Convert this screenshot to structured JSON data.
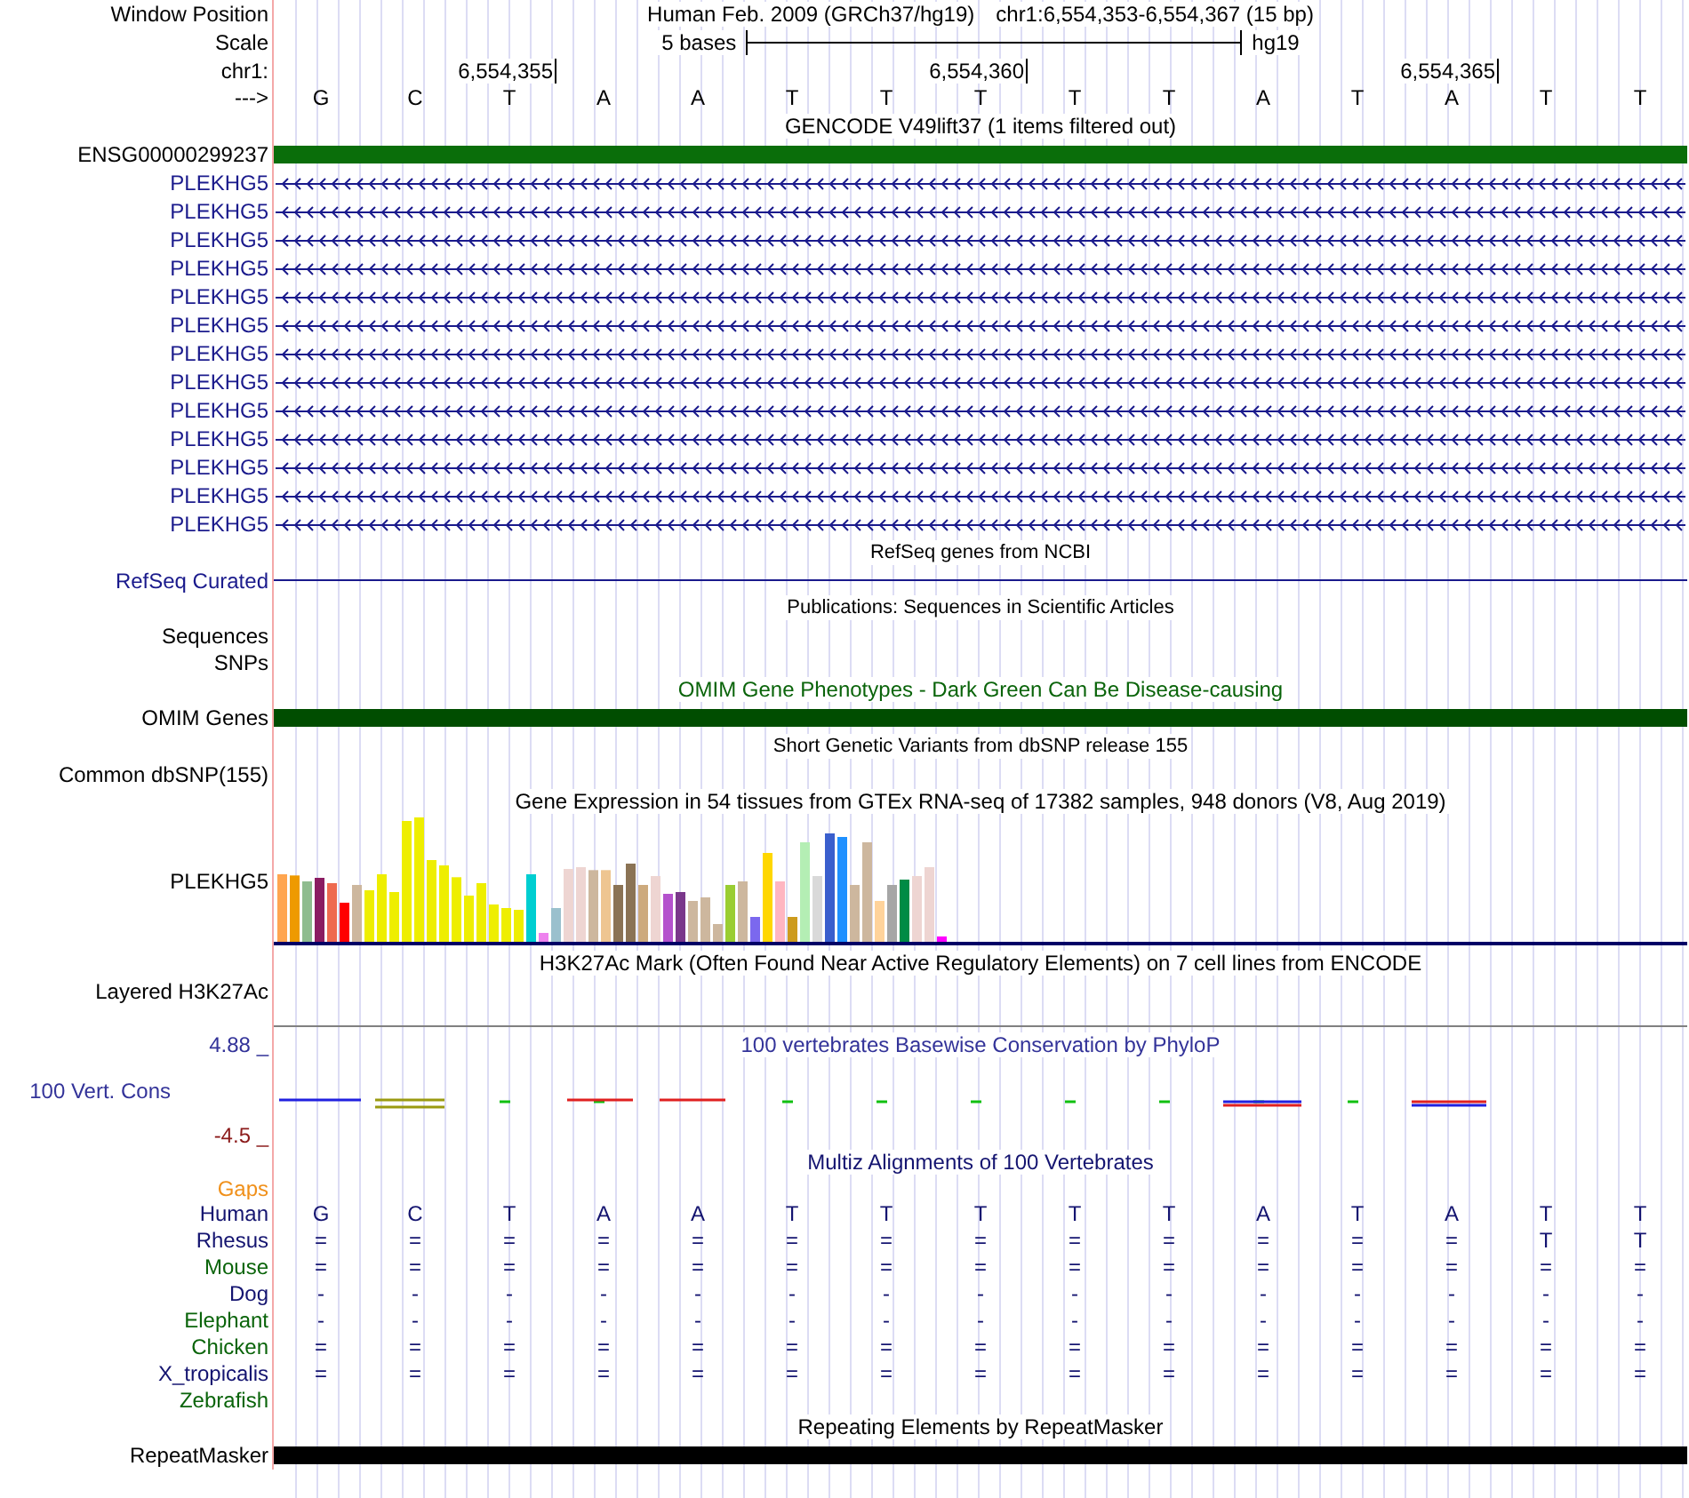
{
  "header": {
    "window_position_label": "Window Position",
    "assembly": "Human Feb. 2009 (GRCh37/hg19)",
    "position": "chr1:6,554,353-6,554,367 (15 bp)",
    "scale_label": "Scale",
    "scale_text": "5 bases",
    "scale_db": "hg19",
    "chrom_label": "chr1:",
    "ticks": [
      "6,554,355",
      "6,554,360",
      "6,554,365"
    ],
    "strand_label": "--->",
    "bases": [
      "G",
      "C",
      "T",
      "A",
      "A",
      "T",
      "T",
      "T",
      "T",
      "T",
      "A",
      "T",
      "A",
      "T",
      "T"
    ]
  },
  "tracks": [
    {
      "kind": "title",
      "text": "GENCODE V49lift37 (1 items filtered out)",
      "color": "#000000"
    },
    {
      "kind": "bar",
      "label": "ENSG00000299237",
      "color": "#0a6e0a"
    },
    {
      "kind": "gene",
      "label": "PLEKHG5",
      "color": "#1a1a8c"
    },
    {
      "kind": "gene",
      "label": "PLEKHG5",
      "color": "#1a1a8c"
    },
    {
      "kind": "gene",
      "label": "PLEKHG5",
      "color": "#1a1a8c"
    },
    {
      "kind": "gene",
      "label": "PLEKHG5",
      "color": "#1a1a8c"
    },
    {
      "kind": "gene",
      "label": "PLEKHG5",
      "color": "#1a1a8c"
    },
    {
      "kind": "gene",
      "label": "PLEKHG5",
      "color": "#1a1a8c"
    },
    {
      "kind": "gene",
      "label": "PLEKHG5",
      "color": "#1a1a8c"
    },
    {
      "kind": "gene",
      "label": "PLEKHG5",
      "color": "#1a1a8c"
    },
    {
      "kind": "gene",
      "label": "PLEKHG5",
      "color": "#1a1a8c"
    },
    {
      "kind": "gene",
      "label": "PLEKHG5",
      "color": "#1a1a8c"
    },
    {
      "kind": "gene",
      "label": "PLEKHG5",
      "color": "#1a1a8c"
    },
    {
      "kind": "gene",
      "label": "PLEKHG5",
      "color": "#1a1a8c"
    },
    {
      "kind": "gene",
      "label": "PLEKHG5",
      "color": "#1a1a8c"
    },
    {
      "kind": "subtitle",
      "text": "RefSeq genes from NCBI",
      "color": "#000000"
    },
    {
      "kind": "line",
      "label": "RefSeq Curated",
      "color": "#1a1a8c"
    },
    {
      "kind": "subtitle",
      "text": "Publications: Sequences in Scientific Articles",
      "color": "#000000"
    },
    {
      "kind": "label",
      "label": "Sequences",
      "color": "#000000"
    },
    {
      "kind": "label",
      "label": "SNPs",
      "color": "#000000"
    },
    {
      "kind": "title",
      "text": "OMIM Gene Phenotypes - Dark Green Can Be Disease-causing",
      "color": "#0a640a"
    },
    {
      "kind": "bar",
      "label": "OMIM Genes",
      "color": "#004d00"
    },
    {
      "kind": "subtitle",
      "text": "Short Genetic Variants from dbSNP release 155",
      "color": "#000000"
    },
    {
      "kind": "label",
      "label": "Common dbSNP(155)",
      "color": "#000000"
    },
    {
      "kind": "title",
      "text": "Gene Expression in 54 tissues from GTEx RNA-seq of 17382 samples, 948 donors (V8, Aug 2019)",
      "color": "#000000"
    },
    {
      "kind": "expression",
      "label": "PLEKHG5",
      "color": "#000000"
    },
    {
      "kind": "title",
      "text": "H3K27Ac Mark (Often Found Near Active Regulatory Elements) on 7 cell lines from ENCODE",
      "color": "#000000"
    },
    {
      "kind": "layered",
      "label": "Layered H3K27Ac",
      "color": "#000000"
    },
    {
      "kind": "conservation",
      "label": "100 Vert. Cons",
      "max": "4.88 _",
      "min": "-4.5 _",
      "text": "100 vertebrates Basewise Conservation by PhyloP",
      "color": "#333399"
    },
    {
      "kind": "title",
      "text": "Multiz Alignments of 100 Vertebrates",
      "color": "#141470"
    },
    {
      "kind": "label",
      "label": "Gaps",
      "color": "#f0901a"
    },
    {
      "kind": "alignment",
      "species": [
        {
          "name": "Human",
          "color": "#141470",
          "bases": [
            "G",
            "C",
            "T",
            "A",
            "A",
            "T",
            "T",
            "T",
            "T",
            "T",
            "A",
            "T",
            "A",
            "T",
            "T"
          ]
        },
        {
          "name": "Rhesus",
          "color": "#141470",
          "bases": [
            "=",
            "=",
            "=",
            "=",
            "=",
            "=",
            "=",
            "=",
            "=",
            "=",
            "=",
            "=",
            "=",
            "T",
            "T"
          ]
        },
        {
          "name": "Mouse",
          "color": "#0a640a",
          "bases": [
            "=",
            "=",
            "=",
            "=",
            "=",
            "=",
            "=",
            "=",
            "=",
            "=",
            "=",
            "=",
            "=",
            "=",
            "="
          ]
        },
        {
          "name": "Dog",
          "color": "#141470",
          "bases": [
            "-",
            "-",
            "-",
            "-",
            "-",
            "-",
            "-",
            "-",
            "-",
            "-",
            "-",
            "-",
            "-",
            "-",
            "-"
          ]
        },
        {
          "name": "Elephant",
          "color": "#0a640a",
          "bases": [
            "-",
            "-",
            "-",
            "-",
            "-",
            "-",
            "-",
            "-",
            "-",
            "-",
            "-",
            "-",
            "-",
            "-",
            "-"
          ]
        },
        {
          "name": "Chicken",
          "color": "#0a640a",
          "bases": [
            "=",
            "=",
            "=",
            "=",
            "=",
            "=",
            "=",
            "=",
            "=",
            "=",
            "=",
            "=",
            "=",
            "=",
            "="
          ]
        },
        {
          "name": "X_tropicalis",
          "color": "#141470",
          "bases": [
            "=",
            "=",
            "=",
            "=",
            "=",
            "=",
            "=",
            "=",
            "=",
            "=",
            "=",
            "=",
            "=",
            "=",
            "="
          ]
        },
        {
          "name": "Zebrafish",
          "color": "#0a640a"
        }
      ]
    },
    {
      "kind": "title",
      "text": "Repeating Elements by RepeatMasker",
      "color": "#000000"
    },
    {
      "kind": "bar",
      "label": "RepeatMasker",
      "color": "#000000"
    }
  ]
}
